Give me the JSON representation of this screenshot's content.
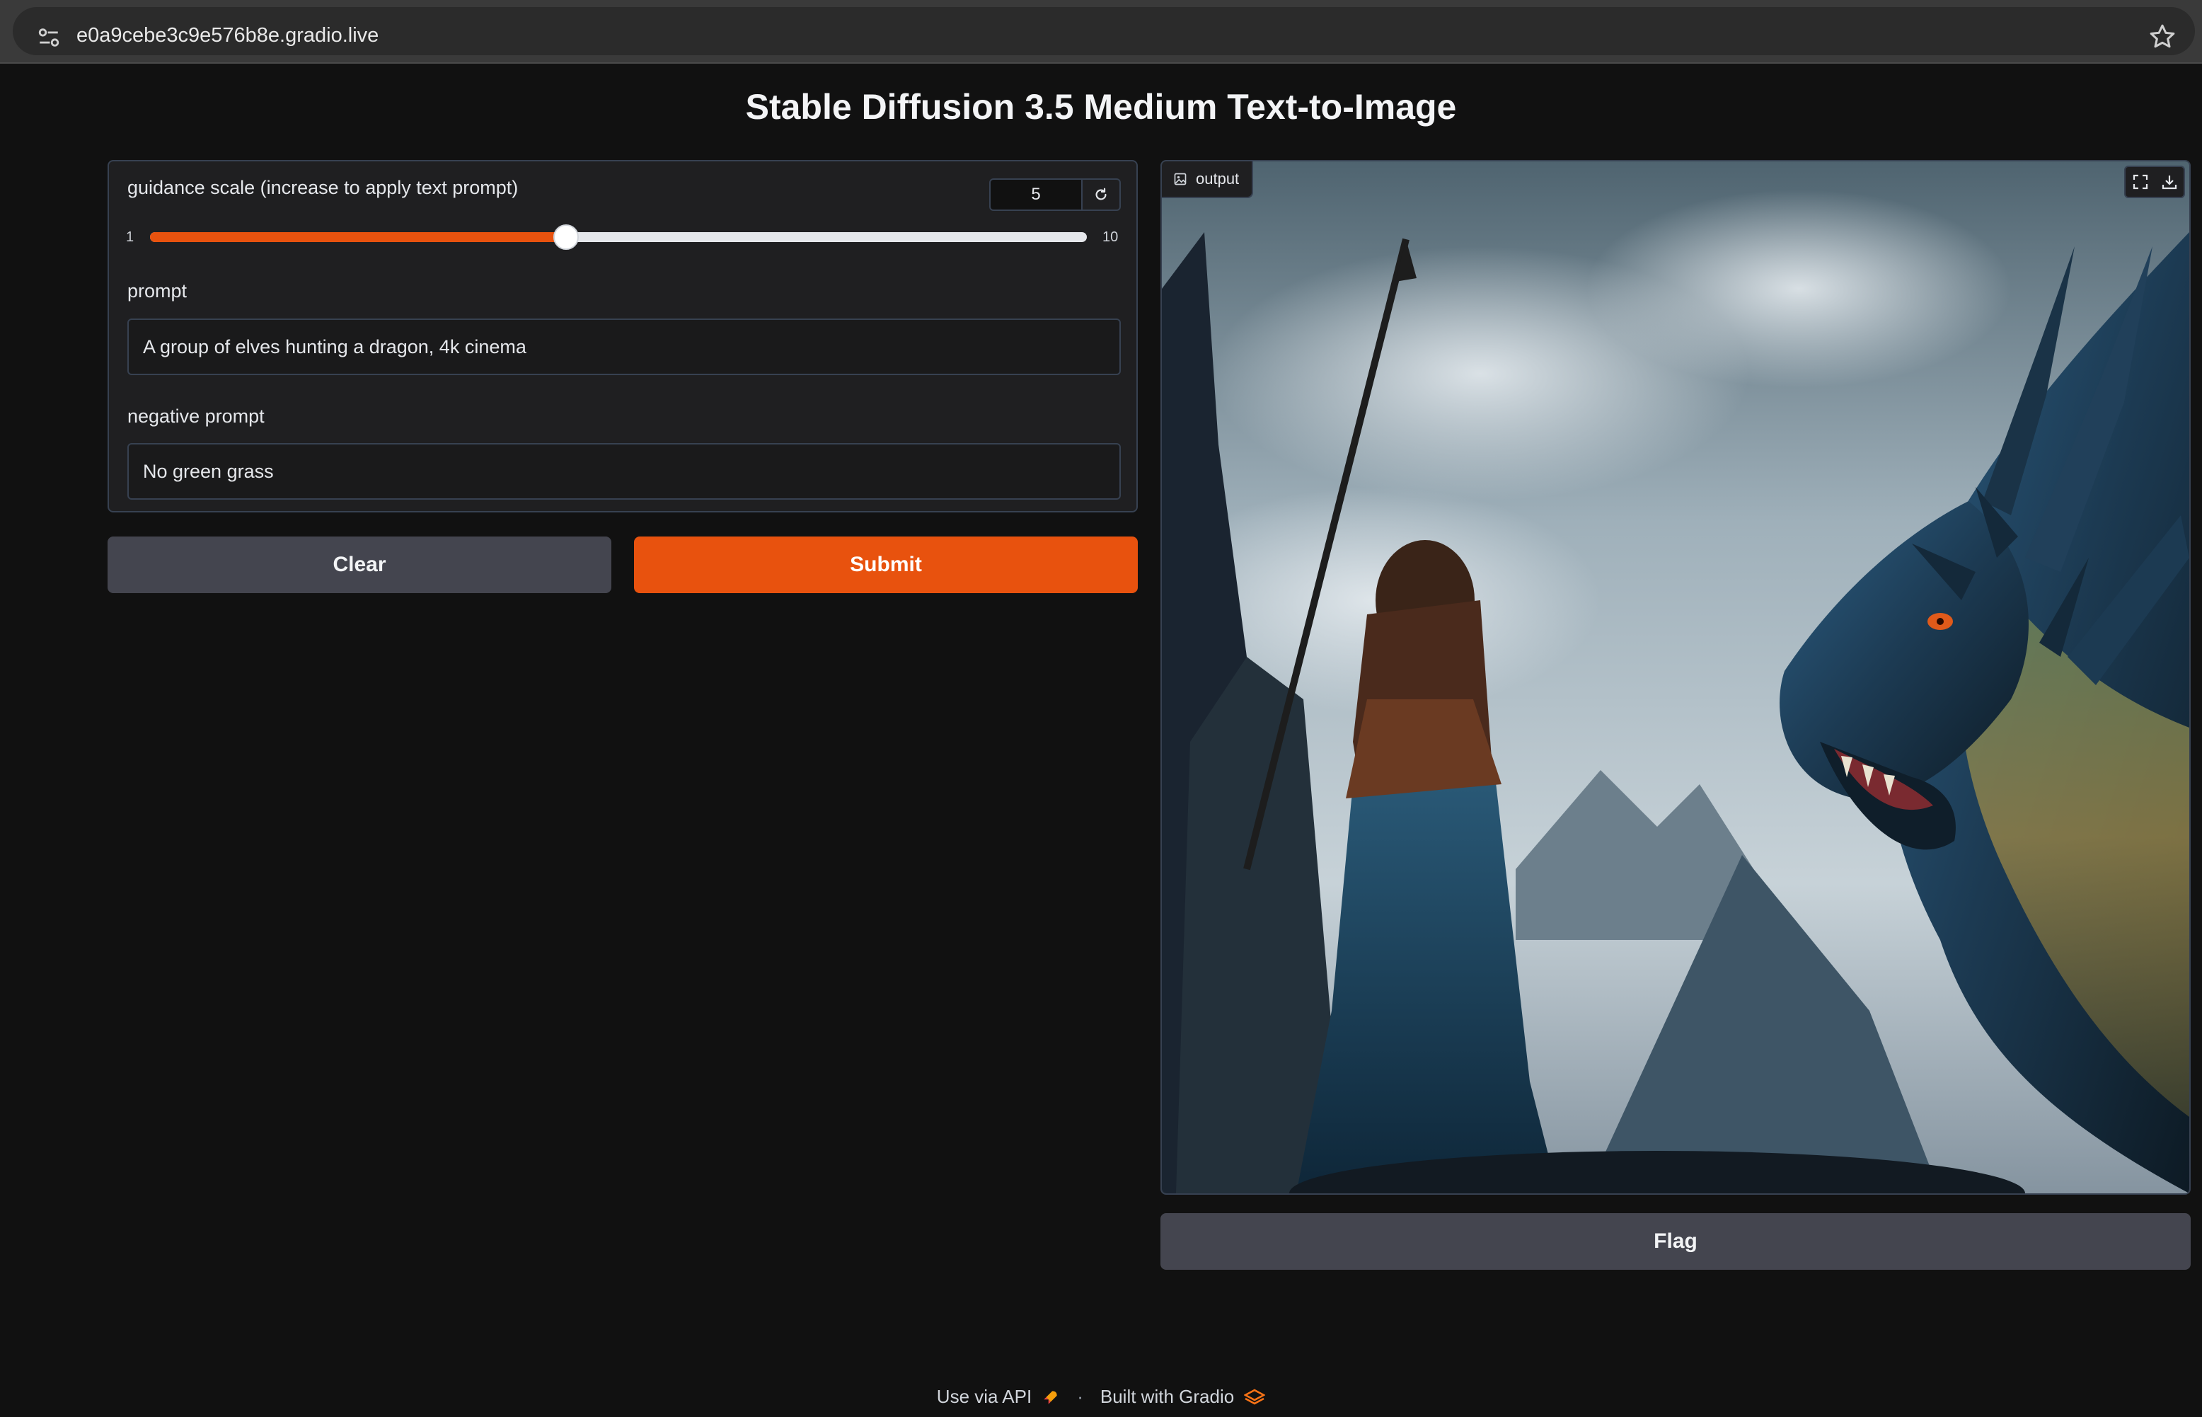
{
  "browser": {
    "url": "e0a9cebe3c9e576b8e.gradio.live"
  },
  "app": {
    "title": "Stable Diffusion 3.5 Medium Text-to-Image"
  },
  "guidance": {
    "label": "guidance scale (increase to apply text prompt)",
    "value": "5",
    "min": "1",
    "max": "10",
    "fraction": 0.4444
  },
  "prompt": {
    "label": "prompt",
    "value": "A group of elves hunting a dragon, 4k cinema"
  },
  "negative_prompt": {
    "label": "negative prompt",
    "value": "No green grass"
  },
  "buttons": {
    "clear": "Clear",
    "submit": "Submit",
    "flag": "Flag"
  },
  "output": {
    "label": "output"
  },
  "footer": {
    "api": "Use via API",
    "built": "Built with Gradio"
  },
  "colors": {
    "accent": "#e8520e",
    "background": "#111111",
    "panel": "#1f1f21",
    "secondary_button": "#44454f"
  },
  "icons": [
    "site-settings-icon",
    "bookmark-star-icon",
    "reset-icon",
    "image-icon",
    "fullscreen-icon",
    "download-icon",
    "rocket-icon",
    "gradio-logo-icon"
  ]
}
